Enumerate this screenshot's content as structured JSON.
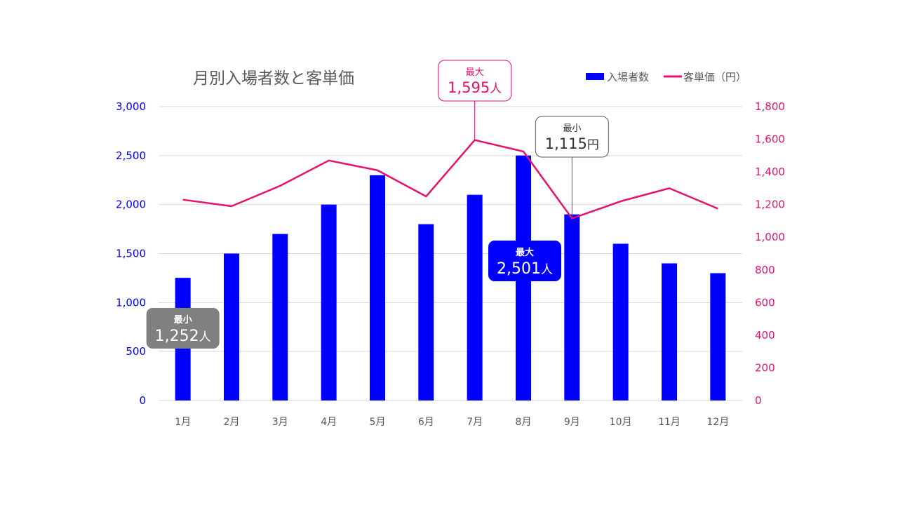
{
  "chart_data": {
    "type": "bar",
    "title": "月別入場者数と客単価",
    "categories": [
      "1月",
      "2月",
      "3月",
      "4月",
      "5月",
      "6月",
      "7月",
      "8月",
      "9月",
      "10月",
      "11月",
      "12月"
    ],
    "series": [
      {
        "name": "入場者数",
        "type": "bar",
        "axis": "left",
        "color": "#0000ff",
        "values": [
          1252,
          1500,
          1700,
          2000,
          2300,
          1800,
          2100,
          2501,
          1900,
          1600,
          1400,
          1300
        ]
      },
      {
        "name": "客単価（円）",
        "type": "line",
        "axis": "right",
        "color": "#e8106a",
        "values": [
          1230,
          1190,
          1315,
          1470,
          1410,
          1250,
          1595,
          1525,
          1115,
          1220,
          1300,
          1175
        ]
      }
    ],
    "y_left": {
      "min": 0,
      "max": 3000,
      "ticks": [
        "0",
        "500",
        "1,000",
        "1,500",
        "2,000",
        "2,500",
        "3,000"
      ]
    },
    "y_right": {
      "min": 0,
      "max": 1800,
      "ticks": [
        "0",
        "200",
        "400",
        "600",
        "800",
        "1,000",
        "1,200",
        "1,400",
        "1,600",
        "1,800"
      ]
    },
    "legend": {
      "placement": "top-right",
      "items": [
        "入場者数",
        "客単価（円）"
      ]
    },
    "grid": true,
    "annotations": [
      {
        "series": 0,
        "index": 0,
        "label": "最小",
        "value": "1,252",
        "unit": "人",
        "style": "filled",
        "color": "#808080"
      },
      {
        "series": 0,
        "index": 7,
        "label": "最大",
        "value": "2,501",
        "unit": "人",
        "style": "filled",
        "color": "#0000ff"
      },
      {
        "series": 1,
        "index": 6,
        "label": "最大",
        "value": "1,595",
        "unit": "人",
        "style": "outline",
        "color": "#e8106a"
      },
      {
        "series": 1,
        "index": 8,
        "label": "最小",
        "value": "1,115",
        "unit": "円",
        "style": "outline",
        "color": "#595959"
      }
    ]
  }
}
